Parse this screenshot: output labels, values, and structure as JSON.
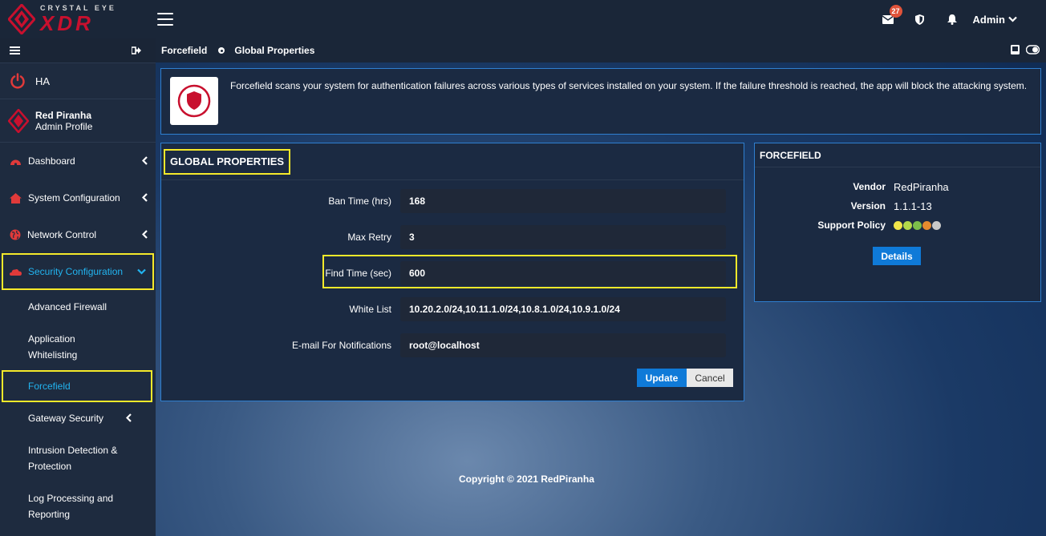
{
  "brand": {
    "top": "CRYSTAL EYE",
    "main": "XDR",
    "accent_color": "#c8102e"
  },
  "topbar": {
    "mail_badge": "27",
    "user_label": "Admin",
    "icons": [
      "menu-icon",
      "mail-icon",
      "shield-icon",
      "bell-icon",
      "chevron-down-icon"
    ]
  },
  "sidebar": {
    "ha_label": "HA",
    "profile": {
      "name": "Red Piranha",
      "role": "Admin Profile"
    },
    "items": [
      {
        "label": "Dashboard",
        "icon": "dashboard-icon"
      },
      {
        "label": "System Configuration",
        "icon": "home-icon"
      },
      {
        "label": "Network Control",
        "icon": "globe-icon"
      },
      {
        "label": "Security Configuration",
        "icon": "cloud-icon"
      }
    ],
    "subitems": [
      {
        "label": "Advanced Firewall"
      },
      {
        "label": "Application Whitelisting"
      },
      {
        "label": "Forcefield"
      },
      {
        "label": "Gateway Security"
      },
      {
        "label": "Intrusion Detection & Protection"
      },
      {
        "label": "Log Processing and Reporting"
      }
    ]
  },
  "breadcrumb": {
    "parent": "Forcefield",
    "current": "Global Properties"
  },
  "info": {
    "text": "Forcefield scans your system for authentication failures across various types of services installed on your system. If the failure threshold is reached, the app will block the attacking system."
  },
  "global_properties": {
    "title": "GLOBAL PROPERTIES",
    "fields": [
      {
        "label": "Ban Time (hrs)",
        "value": "168"
      },
      {
        "label": "Max Retry",
        "value": "3"
      },
      {
        "label": "Find Time (sec)",
        "value": "600"
      },
      {
        "label": "White List",
        "value": "10.20.2.0/24,10.11.1.0/24,10.8.1.0/24,10.9.1.0/24"
      },
      {
        "label": "E-mail For Notifications",
        "value": "root@localhost"
      }
    ],
    "update_label": "Update",
    "cancel_label": "Cancel"
  },
  "forcefield": {
    "title": "FORCEFIELD",
    "vendor_key": "Vendor",
    "vendor": "RedPiranha",
    "version_key": "Version",
    "version": "1.1.1-13",
    "support_key": "Support Policy",
    "support_dots": [
      "#f2e64a",
      "#b4d94a",
      "#7cbf4a",
      "#e58a2e",
      "#c9c9c9"
    ],
    "details_label": "Details"
  },
  "footer": {
    "copyright": "Copyright © 2021 RedPiranha"
  }
}
